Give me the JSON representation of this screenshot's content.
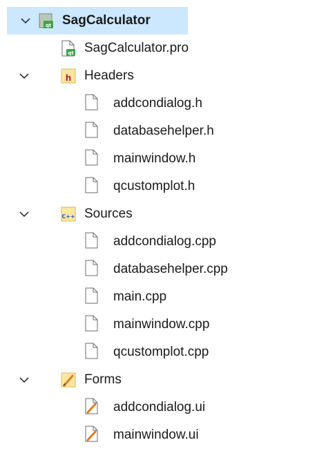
{
  "project": {
    "name": "SagCalculator",
    "pro_file": "SagCalculator.pro"
  },
  "groups": [
    {
      "name": "Headers",
      "icon": "header-folder-icon",
      "files": [
        "addcondialog.h",
        "databasehelper.h",
        "mainwindow.h",
        "qcustomplot.h"
      ]
    },
    {
      "name": "Sources",
      "icon": "cpp-folder-icon",
      "files": [
        "addcondialog.cpp",
        "databasehelper.cpp",
        "main.cpp",
        "mainwindow.cpp",
        "qcustomplot.cpp"
      ]
    },
    {
      "name": "Forms",
      "icon": "forms-folder-icon",
      "files": [
        "addcondialog.ui",
        "mainwindow.ui"
      ]
    }
  ],
  "colors": {
    "selection": "#cce8ff",
    "qt_green": "#3ea743",
    "header_red": "#c4192c",
    "folder_yellow": "#f5d96b",
    "pencil_orange": "#e07a1f"
  }
}
